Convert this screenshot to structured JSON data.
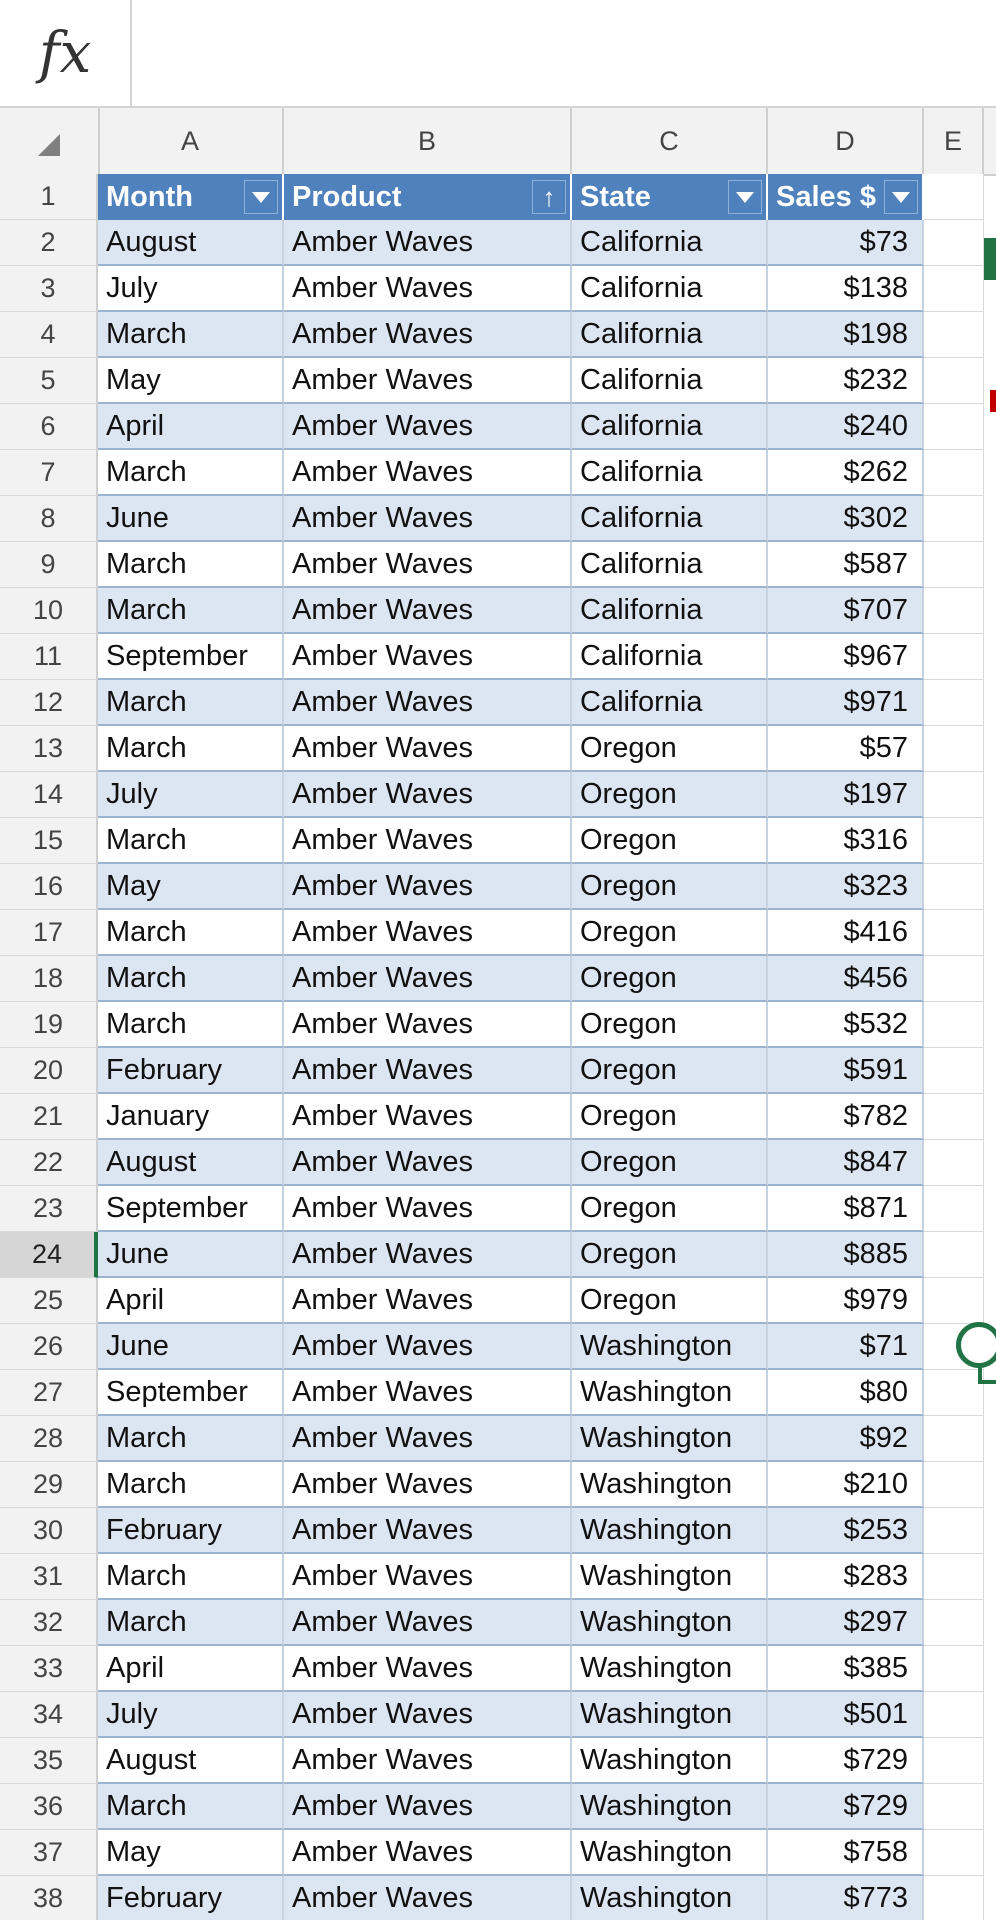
{
  "formula_bar": {
    "fx_label": "fx",
    "content": ""
  },
  "columns": [
    "A",
    "B",
    "C",
    "D",
    "E"
  ],
  "table_headers": [
    "Month",
    "Product",
    "State",
    "Sales $"
  ],
  "row_numbers": [
    "1",
    "2",
    "3",
    "4",
    "5",
    "6",
    "7",
    "8",
    "9",
    "10",
    "11",
    "12",
    "13",
    "14",
    "15",
    "16",
    "17",
    "18",
    "19",
    "20",
    "21",
    "22",
    "23",
    "24",
    "25",
    "26",
    "27",
    "28",
    "29",
    "30",
    "31",
    "32",
    "33",
    "34",
    "35",
    "36",
    "37",
    "38"
  ],
  "rows": [
    [
      "August",
      "Amber Waves",
      "California",
      "$73"
    ],
    [
      "July",
      "Amber Waves",
      "California",
      "$138"
    ],
    [
      "March",
      "Amber Waves",
      "California",
      "$198"
    ],
    [
      "May",
      "Amber Waves",
      "California",
      "$232"
    ],
    [
      "April",
      "Amber Waves",
      "California",
      "$240"
    ],
    [
      "March",
      "Amber Waves",
      "California",
      "$262"
    ],
    [
      "June",
      "Amber Waves",
      "California",
      "$302"
    ],
    [
      "March",
      "Amber Waves",
      "California",
      "$587"
    ],
    [
      "March",
      "Amber Waves",
      "California",
      "$707"
    ],
    [
      "September",
      "Amber Waves",
      "California",
      "$967"
    ],
    [
      "March",
      "Amber Waves",
      "California",
      "$971"
    ],
    [
      "March",
      "Amber Waves",
      "Oregon",
      "$57"
    ],
    [
      "July",
      "Amber Waves",
      "Oregon",
      "$197"
    ],
    [
      "March",
      "Amber Waves",
      "Oregon",
      "$316"
    ],
    [
      "May",
      "Amber Waves",
      "Oregon",
      "$323"
    ],
    [
      "March",
      "Amber Waves",
      "Oregon",
      "$416"
    ],
    [
      "March",
      "Amber Waves",
      "Oregon",
      "$456"
    ],
    [
      "March",
      "Amber Waves",
      "Oregon",
      "$532"
    ],
    [
      "February",
      "Amber Waves",
      "Oregon",
      "$591"
    ],
    [
      "January",
      "Amber Waves",
      "Oregon",
      "$782"
    ],
    [
      "August",
      "Amber Waves",
      "Oregon",
      "$847"
    ],
    [
      "September",
      "Amber Waves",
      "Oregon",
      "$871"
    ],
    [
      "June",
      "Amber Waves",
      "Oregon",
      "$885"
    ],
    [
      "April",
      "Amber Waves",
      "Oregon",
      "$979"
    ],
    [
      "June",
      "Amber Waves",
      "Washington",
      "$71"
    ],
    [
      "September",
      "Amber Waves",
      "Washington",
      "$80"
    ],
    [
      "March",
      "Amber Waves",
      "Washington",
      "$92"
    ],
    [
      "March",
      "Amber Waves",
      "Washington",
      "$210"
    ],
    [
      "February",
      "Amber Waves",
      "Washington",
      "$253"
    ],
    [
      "March",
      "Amber Waves",
      "Washington",
      "$283"
    ],
    [
      "March",
      "Amber Waves",
      "Washington",
      "$297"
    ],
    [
      "April",
      "Amber Waves",
      "Washington",
      "$385"
    ],
    [
      "July",
      "Amber Waves",
      "Washington",
      "$501"
    ],
    [
      "August",
      "Amber Waves",
      "Washington",
      "$729"
    ],
    [
      "March",
      "Amber Waves",
      "Washington",
      "$729"
    ],
    [
      "May",
      "Amber Waves",
      "Washington",
      "$758"
    ],
    [
      "February",
      "Amber Waves",
      "Washington",
      "$773"
    ]
  ],
  "selected_row": "24",
  "colors": {
    "header_blue": "#4f81bd",
    "band_blue": "#dce6f2",
    "excel_green": "#217346"
  }
}
